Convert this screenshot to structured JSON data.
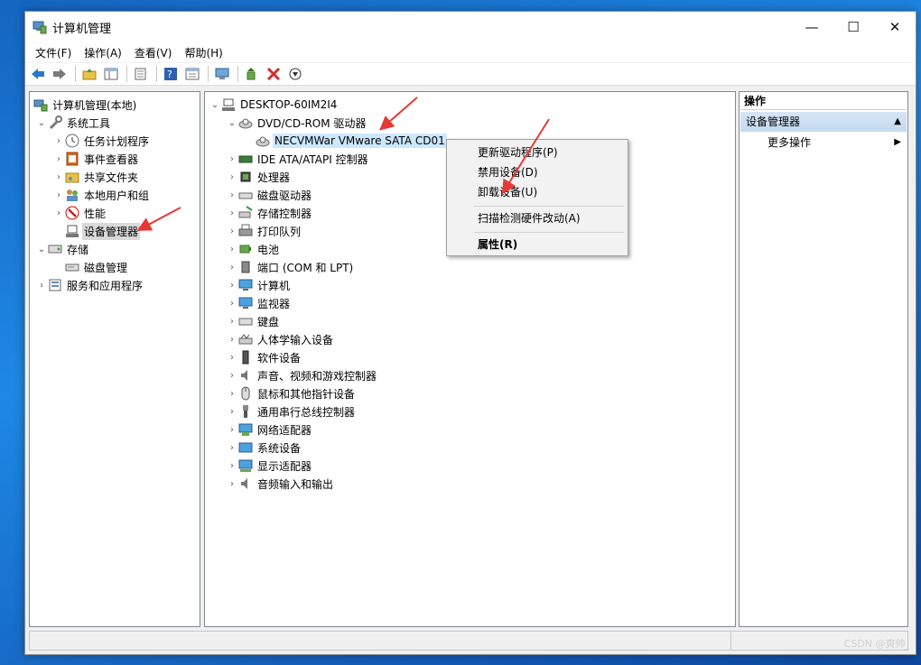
{
  "window": {
    "title": "计算机管理",
    "controls": {
      "minimize": "—",
      "maximize": "☐",
      "close": "✕"
    }
  },
  "menubar": [
    "文件(F)",
    "操作(A)",
    "查看(V)",
    "帮助(H)"
  ],
  "toolbar": [
    "back-icon",
    "forward-icon",
    "up-folder-icon",
    "show-hide-tree-icon",
    "export-list-icon",
    "help-icon",
    "properties-icon",
    "computer-icon",
    "update-driver-icon",
    "uninstall-icon",
    "enable-device-icon"
  ],
  "left_tree": {
    "root": "计算机管理(本地)",
    "system_tools": "系统工具",
    "task_scheduler": "任务计划程序",
    "event_viewer": "事件查看器",
    "shared_folders": "共享文件夹",
    "local_users": "本地用户和组",
    "performance": "性能",
    "device_manager": "设备管理器",
    "storage": "存储",
    "disk_management": "磁盘管理",
    "services_apps": "服务和应用程序"
  },
  "device_tree": {
    "computer": "DESKTOP-60IM2I4",
    "dvd_category": "DVD/CD-ROM 驱动器",
    "dvd_device": "NECVMWar VMware SATA CD01",
    "categories": [
      "IDE ATA/ATAPI 控制器",
      "处理器",
      "磁盘驱动器",
      "存储控制器",
      "打印队列",
      "电池",
      "端口 (COM 和 LPT)",
      "计算机",
      "监视器",
      "键盘",
      "人体学输入设备",
      "软件设备",
      "声音、视频和游戏控制器",
      "鼠标和其他指针设备",
      "通用串行总线控制器",
      "网络适配器",
      "系统设备",
      "显示适配器",
      "音频输入和输出"
    ]
  },
  "context_menu": {
    "update_driver": "更新驱动程序(P)",
    "disable_device": "禁用设备(D)",
    "uninstall_device": "卸载设备(U)",
    "scan_hardware": "扫描检测硬件改动(A)",
    "properties": "属性(R)"
  },
  "actions": {
    "header": "操作",
    "section": "设备管理器",
    "more": "更多操作"
  },
  "watermark": "CSDN @爽帅_",
  "colors": {
    "selection": "#cce8ff",
    "annotation_arrow": "#e53935"
  }
}
